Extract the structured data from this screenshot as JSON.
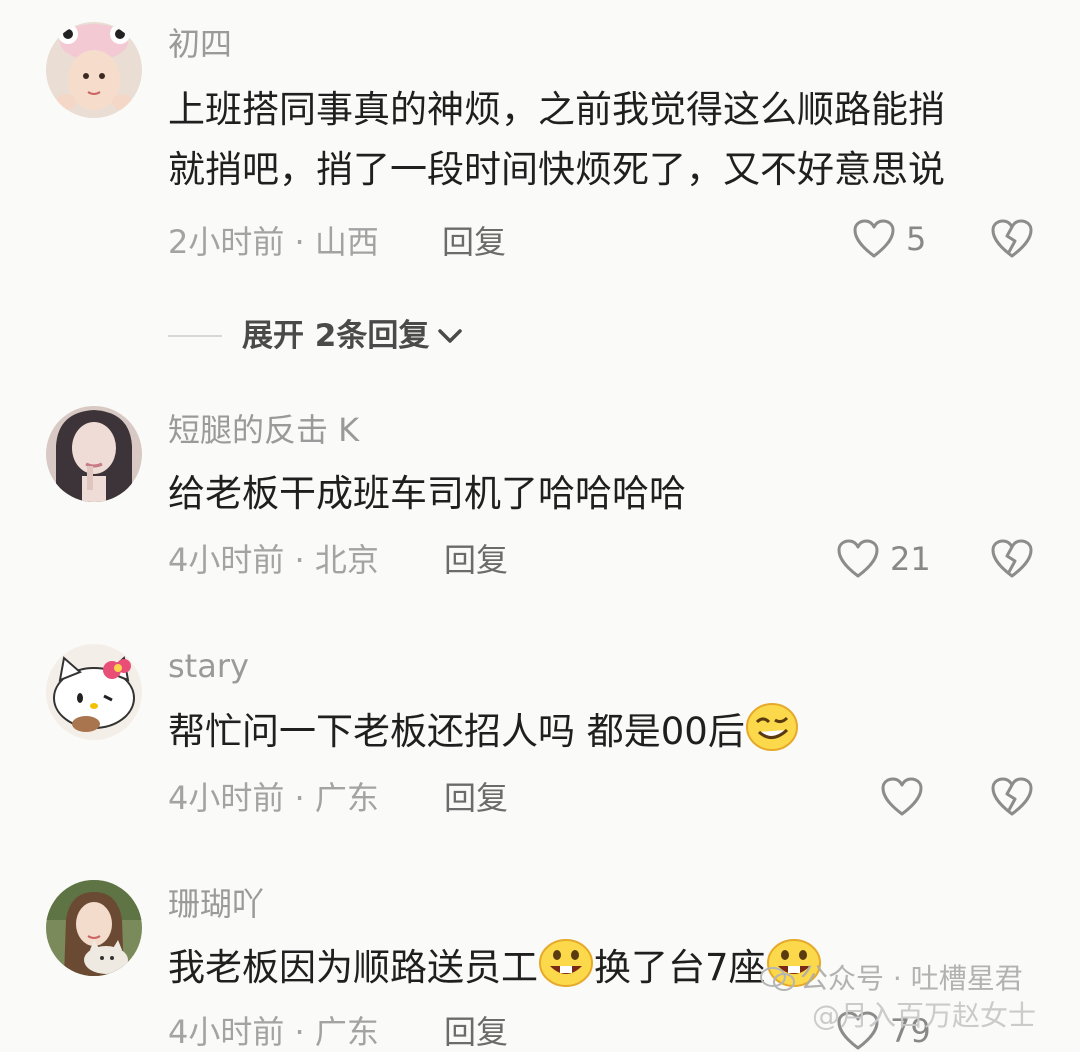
{
  "comments": [
    {
      "username": "初四",
      "lines": [
        "上班搭同事真的神烦，之前我觉得这么顺路能捎",
        "就捎吧，捎了一段时间快烦死了，又不好意思说"
      ],
      "meta": "2小时前 · 山西",
      "reply": "回复",
      "likes": "5",
      "avatar_icon": "girl-cat-ears-avatar"
    },
    {
      "username": "短腿的反击 K",
      "lines": [
        "给老板干成班车司机了哈哈哈哈"
      ],
      "meta": "4小时前 · 北京",
      "reply": "回复",
      "likes": "21",
      "avatar_icon": "woman-dark-hair-avatar"
    },
    {
      "username": "stary",
      "lines": [
        "帮忙问一下老板还招人吗 都是00后"
      ],
      "meta": "4小时前 · 广东",
      "reply": "回复",
      "likes": "",
      "avatar_icon": "hello-kitty-avatar"
    },
    {
      "username": "珊瑚吖",
      "lines": [
        "我老板因为顺路送员工",
        "换了台7座"
      ],
      "meta": "4小时前 · 广东",
      "reply": "回复",
      "likes": "79",
      "avatar_icon": "girl-with-cat-avatar"
    }
  ],
  "expand_replies": "展开 2条回复",
  "watermark": {
    "line1": "公众号 · 吐槽星君",
    "line2": "@月入百万赵女士"
  },
  "colors": {
    "background": "#fafaf8",
    "text": "#1f1f1f",
    "secondary": "#a3a3a3"
  }
}
